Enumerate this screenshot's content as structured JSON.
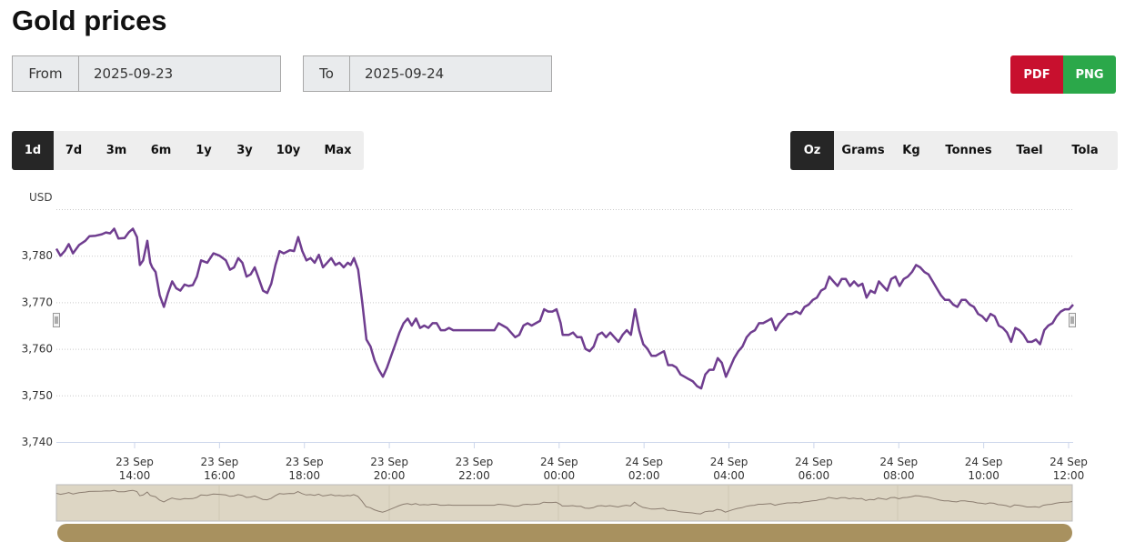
{
  "page": {
    "title": "Gold prices"
  },
  "date_range": {
    "from_label": "From",
    "from_value": "2025-09-23",
    "to_label": "To",
    "to_value": "2025-09-24"
  },
  "export": {
    "pdf_label": "PDF",
    "png_label": "PNG",
    "pdf_color": "#c8102e",
    "png_color": "#2ba84a"
  },
  "range_options": [
    "1d",
    "7d",
    "3m",
    "6m",
    "1y",
    "3y",
    "10y",
    "Max"
  ],
  "range_selected": "1d",
  "unit_options": [
    "Oz",
    "Grams",
    "Kg",
    "Tonnes",
    "Tael",
    "Tola"
  ],
  "unit_selected": "Oz",
  "chart_data": {
    "type": "line",
    "title": "",
    "ylabel": "USD",
    "ylim": [
      3740,
      3790
    ],
    "yticks": [
      "3,740",
      "3,750",
      "3,760",
      "3,770",
      "3,780"
    ],
    "ytick_values": [
      3740,
      3750,
      3760,
      3770,
      3780
    ],
    "xlim_hours": [
      12.8,
      36.0
    ],
    "xticks": [
      {
        "day": "23 Sep",
        "time": "14:00",
        "hour": 14
      },
      {
        "day": "23 Sep",
        "time": "16:00",
        "hour": 16
      },
      {
        "day": "23 Sep",
        "time": "18:00",
        "hour": 18
      },
      {
        "day": "23 Sep",
        "time": "20:00",
        "hour": 20
      },
      {
        "day": "23 Sep",
        "time": "22:00",
        "hour": 22
      },
      {
        "day": "24 Sep",
        "time": "00:00",
        "hour": 24
      },
      {
        "day": "24 Sep",
        "time": "02:00",
        "hour": 26
      },
      {
        "day": "24 Sep",
        "time": "04:00",
        "hour": 28
      },
      {
        "day": "24 Sep",
        "time": "06:00",
        "hour": 30
      },
      {
        "day": "24 Sep",
        "time": "08:00",
        "hour": 32
      },
      {
        "day": "24 Sep",
        "time": "10:00",
        "hour": 34
      },
      {
        "day": "24 Sep",
        "time": "12:00",
        "hour": 36
      }
    ],
    "grid": "horizontal dotted",
    "line_color": "#6f3d8f",
    "series": [
      {
        "name": "",
        "points": [
          [
            12.8,
            3781.5
          ],
          [
            12.9,
            3780.0
          ],
          [
            13.0,
            3781.0
          ],
          [
            13.1,
            3782.5
          ],
          [
            13.2,
            3780.5
          ],
          [
            13.35,
            3782.3
          ],
          [
            13.5,
            3783.2
          ],
          [
            13.6,
            3784.2
          ],
          [
            13.75,
            3784.3
          ],
          [
            13.9,
            3784.6
          ],
          [
            14.0,
            3785.0
          ],
          [
            14.1,
            3784.8
          ],
          [
            14.2,
            3785.8
          ],
          [
            14.3,
            3783.7
          ],
          [
            14.45,
            3783.8
          ],
          [
            14.55,
            3785.0
          ],
          [
            14.65,
            3785.8
          ],
          [
            14.75,
            3784.0
          ],
          [
            14.82,
            3778.0
          ],
          [
            14.9,
            3779.0
          ],
          [
            15.0,
            3783.2
          ],
          [
            15.07,
            3778.5
          ],
          [
            15.12,
            3777.5
          ],
          [
            15.2,
            3776.5
          ],
          [
            15.3,
            3771.5
          ],
          [
            15.4,
            3769.0
          ],
          [
            15.5,
            3772.0
          ],
          [
            15.6,
            3774.5
          ],
          [
            15.7,
            3773.0
          ],
          [
            15.8,
            3772.5
          ],
          [
            15.9,
            3773.8
          ],
          [
            16.0,
            3773.5
          ],
          [
            16.1,
            3773.7
          ],
          [
            16.2,
            3775.5
          ],
          [
            16.3,
            3779.0
          ],
          [
            16.45,
            3778.5
          ],
          [
            16.6,
            3780.5
          ],
          [
            16.75,
            3780.0
          ],
          [
            16.9,
            3779.0
          ],
          [
            17.0,
            3777.0
          ],
          [
            17.1,
            3777.5
          ],
          [
            17.2,
            3779.5
          ],
          [
            17.3,
            3778.5
          ],
          [
            17.4,
            3775.5
          ],
          [
            17.5,
            3776.0
          ],
          [
            17.6,
            3777.5
          ],
          [
            17.7,
            3775.0
          ],
          [
            17.8,
            3772.5
          ],
          [
            17.9,
            3772.0
          ],
          [
            18.0,
            3774.0
          ],
          [
            18.1,
            3778.0
          ],
          [
            18.2,
            3781.0
          ],
          [
            18.3,
            3780.5
          ],
          [
            18.45,
            3781.2
          ],
          [
            18.55,
            3781.0
          ],
          [
            18.65,
            3784.0
          ],
          [
            18.75,
            3781.0
          ],
          [
            18.85,
            3779.0
          ],
          [
            18.95,
            3779.5
          ],
          [
            19.05,
            3778.5
          ],
          [
            19.15,
            3780.2
          ],
          [
            19.25,
            3777.5
          ],
          [
            19.35,
            3778.5
          ],
          [
            19.45,
            3779.5
          ],
          [
            19.55,
            3778.0
          ],
          [
            19.65,
            3778.5
          ],
          [
            19.75,
            3777.5
          ],
          [
            19.85,
            3778.5
          ],
          [
            19.92,
            3778.0
          ],
          [
            20.0,
            3779.5
          ],
          [
            20.1,
            3777.0
          ],
          [
            20.2,
            3770.0
          ],
          [
            20.3,
            3762.0
          ],
          [
            20.4,
            3760.5
          ],
          [
            20.5,
            3757.5
          ],
          [
            20.6,
            3755.5
          ],
          [
            20.7,
            3754.0
          ],
          [
            20.8,
            3756.0
          ],
          [
            20.9,
            3758.5
          ],
          [
            21.0,
            3761.0
          ],
          [
            21.1,
            3763.5
          ],
          [
            21.2,
            3765.5
          ],
          [
            21.3,
            3766.5
          ],
          [
            21.4,
            3765.0
          ],
          [
            21.5,
            3766.5
          ],
          [
            21.6,
            3764.5
          ],
          [
            21.7,
            3765.0
          ],
          [
            21.8,
            3764.5
          ],
          [
            21.9,
            3765.5
          ],
          [
            22.0,
            3765.5
          ],
          [
            22.1,
            3764.0
          ],
          [
            22.2,
            3764.0
          ],
          [
            22.3,
            3764.5
          ],
          [
            22.4,
            3764.0
          ],
          [
            23.4,
            3764.0
          ],
          [
            23.5,
            3765.5
          ],
          [
            23.6,
            3765.0
          ],
          [
            23.7,
            3764.5
          ],
          [
            23.8,
            3763.5
          ],
          [
            23.9,
            3762.5
          ],
          [
            24.0,
            3763.0
          ],
          [
            24.1,
            3765.0
          ],
          [
            24.2,
            3765.5
          ],
          [
            24.3,
            3765.0
          ],
          [
            24.4,
            3765.5
          ],
          [
            24.5,
            3766.0
          ],
          [
            24.6,
            3768.5
          ],
          [
            24.7,
            3768.0
          ],
          [
            24.8,
            3768.0
          ],
          [
            24.9,
            3768.5
          ],
          [
            25.0,
            3765.5
          ],
          [
            25.05,
            3763.0
          ],
          [
            25.2,
            3763.0
          ],
          [
            25.3,
            3763.5
          ],
          [
            25.4,
            3762.5
          ],
          [
            25.5,
            3762.5
          ],
          [
            25.6,
            3760.0
          ],
          [
            25.7,
            3759.5
          ],
          [
            25.8,
            3760.5
          ],
          [
            25.9,
            3763.0
          ],
          [
            26.0,
            3763.5
          ],
          [
            26.1,
            3762.5
          ],
          [
            26.2,
            3763.5
          ],
          [
            26.3,
            3762.5
          ],
          [
            26.4,
            3761.5
          ],
          [
            26.5,
            3763.0
          ],
          [
            26.6,
            3764.0
          ],
          [
            26.7,
            3763.0
          ],
          [
            26.8,
            3768.5
          ],
          [
            26.9,
            3764.0
          ],
          [
            27.0,
            3761.0
          ],
          [
            27.1,
            3760.0
          ],
          [
            27.2,
            3758.5
          ],
          [
            27.3,
            3758.5
          ],
          [
            27.4,
            3759.0
          ],
          [
            27.5,
            3759.5
          ],
          [
            27.6,
            3756.5
          ],
          [
            27.7,
            3756.5
          ],
          [
            27.8,
            3756.0
          ],
          [
            27.9,
            3754.5
          ],
          [
            28.0,
            3754.0
          ],
          [
            28.1,
            3753.5
          ],
          [
            28.2,
            3753.0
          ],
          [
            28.3,
            3752.0
          ],
          [
            28.4,
            3751.5
          ],
          [
            28.5,
            3754.5
          ],
          [
            28.6,
            3755.5
          ],
          [
            28.7,
            3755.5
          ],
          [
            28.8,
            3758.0
          ],
          [
            28.9,
            3757.0
          ],
          [
            29.0,
            3754.0
          ],
          [
            29.1,
            3756.0
          ],
          [
            29.2,
            3758.0
          ],
          [
            29.3,
            3759.5
          ],
          [
            29.4,
            3760.5
          ],
          [
            29.5,
            3762.5
          ],
          [
            29.6,
            3763.5
          ],
          [
            29.7,
            3764.0
          ],
          [
            29.8,
            3765.5
          ],
          [
            29.9,
            3765.5
          ],
          [
            30.0,
            3766.0
          ],
          [
            30.1,
            3766.5
          ],
          [
            30.2,
            3764.0
          ],
          [
            30.3,
            3765.5
          ],
          [
            30.4,
            3766.5
          ],
          [
            30.5,
            3767.5
          ],
          [
            30.6,
            3767.5
          ],
          [
            30.7,
            3768.0
          ],
          [
            30.8,
            3767.5
          ],
          [
            30.9,
            3769.0
          ],
          [
            31.0,
            3769.5
          ],
          [
            31.1,
            3770.5
          ],
          [
            31.2,
            3771.0
          ],
          [
            31.3,
            3772.5
          ],
          [
            31.4,
            3773.0
          ],
          [
            31.5,
            3775.5
          ],
          [
            31.6,
            3774.5
          ],
          [
            31.7,
            3773.5
          ],
          [
            31.8,
            3775.0
          ],
          [
            31.9,
            3775.0
          ],
          [
            32.0,
            3773.5
          ],
          [
            32.1,
            3774.5
          ],
          [
            32.2,
            3773.5
          ],
          [
            32.3,
            3774.0
          ],
          [
            32.4,
            3771.0
          ],
          [
            32.5,
            3772.5
          ],
          [
            32.6,
            3772.0
          ],
          [
            32.7,
            3774.5
          ],
          [
            32.8,
            3773.5
          ],
          [
            32.9,
            3772.5
          ],
          [
            33.0,
            3775.0
          ],
          [
            33.1,
            3775.5
          ],
          [
            33.2,
            3773.5
          ],
          [
            33.3,
            3775.0
          ],
          [
            33.4,
            3775.5
          ],
          [
            33.5,
            3776.5
          ],
          [
            33.6,
            3778.0
          ],
          [
            33.7,
            3777.5
          ],
          [
            33.8,
            3776.5
          ],
          [
            33.9,
            3776.0
          ],
          [
            34.0,
            3774.5
          ],
          [
            34.1,
            3773.0
          ],
          [
            34.2,
            3771.5
          ],
          [
            34.3,
            3770.5
          ],
          [
            34.4,
            3770.5
          ],
          [
            34.5,
            3769.5
          ],
          [
            34.6,
            3769.0
          ],
          [
            34.7,
            3770.5
          ],
          [
            34.8,
            3770.5
          ],
          [
            34.9,
            3769.5
          ],
          [
            35.0,
            3769.0
          ],
          [
            35.1,
            3767.5
          ],
          [
            35.2,
            3767.0
          ],
          [
            35.3,
            3766.0
          ],
          [
            35.4,
            3767.5
          ],
          [
            35.5,
            3767.0
          ],
          [
            35.6,
            3765.0
          ],
          [
            35.7,
            3764.5
          ],
          [
            35.8,
            3763.5
          ],
          [
            35.9,
            3761.5
          ],
          [
            36.0,
            3764.5
          ],
          [
            36.1,
            3764.0
          ],
          [
            36.2,
            3763.0
          ],
          [
            36.3,
            3761.5
          ],
          [
            36.4,
            3761.5
          ],
          [
            36.5,
            3762.0
          ],
          [
            36.6,
            3761.0
          ],
          [
            36.7,
            3764.0
          ],
          [
            36.8,
            3765.0
          ],
          [
            36.9,
            3765.5
          ],
          [
            37.0,
            3767.0
          ],
          [
            37.1,
            3768.0
          ],
          [
            37.2,
            3768.5
          ],
          [
            37.3,
            3768.5
          ],
          [
            37.4,
            3769.5
          ]
        ]
      }
    ]
  },
  "navigator": {
    "fill_color": "#ddd6c4",
    "line_color": "#8b7d70",
    "scrollbar_color": "#a8915f"
  }
}
